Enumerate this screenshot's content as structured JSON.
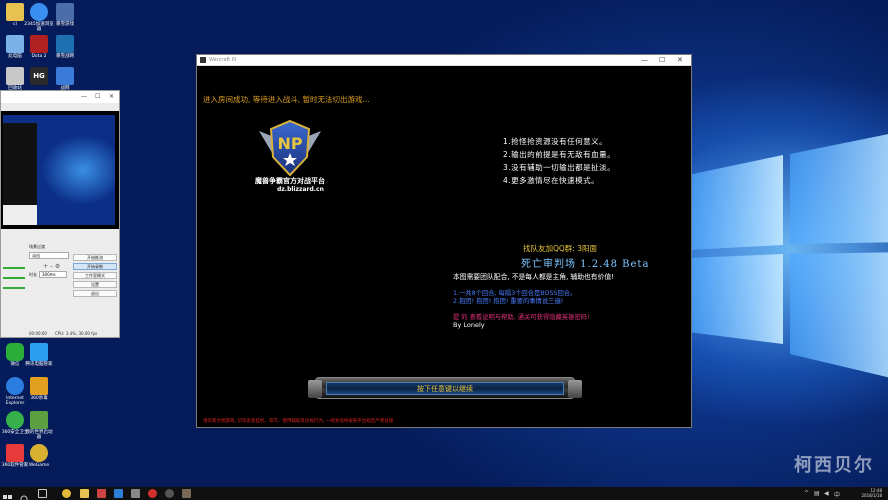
{
  "desktop": {
    "icons": [
      {
        "label": "cl",
        "color": "#e8c150"
      },
      {
        "label": "2345加速浏览器",
        "color": "#3a8ef0"
      },
      {
        "label": "暴雪游戏",
        "color": "#4b6ea8"
      },
      {
        "label": "此电脑",
        "color": "#7ab2e8"
      },
      {
        "label": "Dota 2",
        "color": "#b02020"
      },
      {
        "label": "暴雪战网",
        "color": "#1d6fb0"
      },
      {
        "label": "回收站",
        "color": "#c8c8c8"
      },
      {
        "label": "HG",
        "color": "#2a2a2a"
      },
      {
        "label": "战网",
        "color": "#3a7ad8"
      },
      {
        "label": "微信",
        "color": "#2aae3a"
      },
      {
        "label": "腾讯电脑管家",
        "color": "#2b9ef0"
      },
      {
        "label": "Internet Explorer",
        "color": "#2b7de0"
      },
      {
        "label": "360杀毒",
        "color": "#e3a020"
      },
      {
        "label": "360安全卫士",
        "color": "#36b04a"
      },
      {
        "label": "我的世界启动器",
        "color": "#5aa040"
      },
      {
        "label": "360软件管家",
        "color": "#e83a3a"
      },
      {
        "label": "WeGame",
        "color": "#d8b030"
      }
    ],
    "watermark": "柯西贝尔"
  },
  "obs": {
    "scene_label": "场景过渡",
    "transition_value": "淡出",
    "duration_label": "时长",
    "duration_value": "300ms",
    "buttons": [
      "开始推流",
      "开始录制",
      "工作室模式",
      "设置",
      "退出"
    ],
    "status_left": "00:00:00",
    "status_right": "CPU: 3.4%, 30.00 fps"
  },
  "game": {
    "title": "Warcraft III",
    "status_message": "进入房间成功, 等待进入战斗, 暂时无法切出游戏...",
    "emblem_title": "魔兽争霸官方对战平台",
    "emblem_subtitle": "dz.blizzard.cn",
    "rules": [
      "1.抢怪抢资源没有任何意义。",
      "2.输出的前提是有无敌有血量。",
      "3.没有辅助一切输出都是扯淡。",
      "4.更多激情尽在快速模式。"
    ],
    "qq_group": "找队友加QQ群: 3阳面",
    "map_title": "死亡审判场 1.2.48 Beta",
    "description": "本图需要团队配合, 不是每人都是主角, 辅助也有价值!",
    "info_line1": "1.一共8个回合, 每隔3个回合是BOSS回合。",
    "info_line2": "2.抱团! 抱团! 抱团! 重要的事情说三遍!",
    "hint_part1": "提 的",
    "hint_part2": "查看说明与帮助, 通关可获得隐藏英雄密码!",
    "author": "By Lonely",
    "continue_label": "按下任意键以继续",
    "footer_notice": "请玩家文明游戏, 切勿恶意挂机、辱骂、使用辅助等违规行为, 一经发现将按照平台规定严肃处理"
  },
  "taskbar": {
    "clock_time": "12:48",
    "clock_date": "2018/1/18",
    "apps": [
      {
        "name": "task-view",
        "color": "#cccccc"
      },
      {
        "name": "chrome",
        "color": "#e2b93b"
      },
      {
        "name": "file-explorer",
        "color": "#e8c150"
      },
      {
        "name": "store",
        "color": "#2d7fd8"
      },
      {
        "name": "app-red",
        "color": "#d0302a"
      },
      {
        "name": "warcraft",
        "color": "#555555"
      },
      {
        "name": "media",
        "color": "#a0a0a0"
      },
      {
        "name": "app-dark",
        "color": "#666666"
      }
    ]
  }
}
